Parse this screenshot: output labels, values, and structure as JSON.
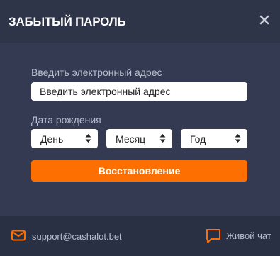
{
  "header": {
    "title": "ЗАБЫТЫЙ ПАРОЛЬ",
    "close_icon": "close-icon"
  },
  "form": {
    "email_label": "Введить электронный адрес",
    "email_placeholder": "Введить электронный адрес",
    "dob_label": "Дата рождения",
    "day": "День",
    "month": "Месяц",
    "year": "Год",
    "submit": "Восстановление"
  },
  "footer": {
    "support_email": "support@cashalot.bet",
    "live_chat": "Живой чат",
    "mail_icon": "mail-icon",
    "chat_icon": "chat-icon"
  },
  "colors": {
    "accent": "#fd6f00",
    "background": "#333a52",
    "header": "#2f3549",
    "footer": "#2a3043"
  }
}
